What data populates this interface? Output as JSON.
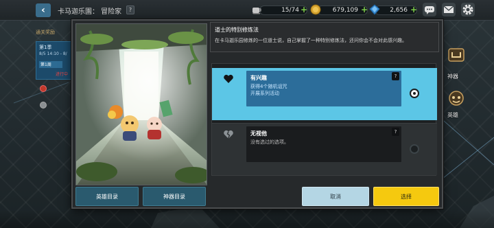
{
  "topbar": {
    "back_icon": "chevron-left-icon",
    "breadcrumb": "卡马迦乐園： 冒险家",
    "help": "?",
    "stamina": {
      "value": "15/74",
      "icon": "coffee-cup-icon"
    },
    "gold": {
      "value": "679,109",
      "icon": "gold-coin-icon"
    },
    "gems": {
      "value": "2,656",
      "icon": "gem-icon"
    },
    "buttons": [
      "chat-icon",
      "mail-icon",
      "gear-icon"
    ]
  },
  "side_panel": {
    "title": "通关奖励",
    "card_line1": "第1季",
    "card_line2": "8/5 14:10 - 8/",
    "card_line3": "第1周",
    "card_line4": "进行中"
  },
  "right_panel": {
    "artifact_label": "神器",
    "hero_label": "英雄"
  },
  "dialog": {
    "title": "道士的特别修炼法",
    "description": "在卡马迦乐园修炼的一位道士说，自己掌握了一种特别修炼法，还问你会不会对此感兴趣。",
    "options": [
      {
        "icon": "heart-icon",
        "title": "有兴趣",
        "lines": [
          "获得4个随机诅咒",
          "开展系列活动"
        ],
        "help": "?",
        "selected": true
      },
      {
        "icon": "broken-heart-icon",
        "title": "无视他",
        "lines": [
          "没有选过的选项。"
        ],
        "help": "?",
        "selected": false
      }
    ],
    "buttons": {
      "hero_list": "英雄目录",
      "artifact_list": "神器目录",
      "cancel": "取消",
      "select": "选择"
    }
  },
  "colors": {
    "selected_option": "#5cc6e6",
    "select_button": "#f5c90f",
    "cancel_button": "#b4d6e4",
    "catalog_button": "#2a5a6e"
  }
}
